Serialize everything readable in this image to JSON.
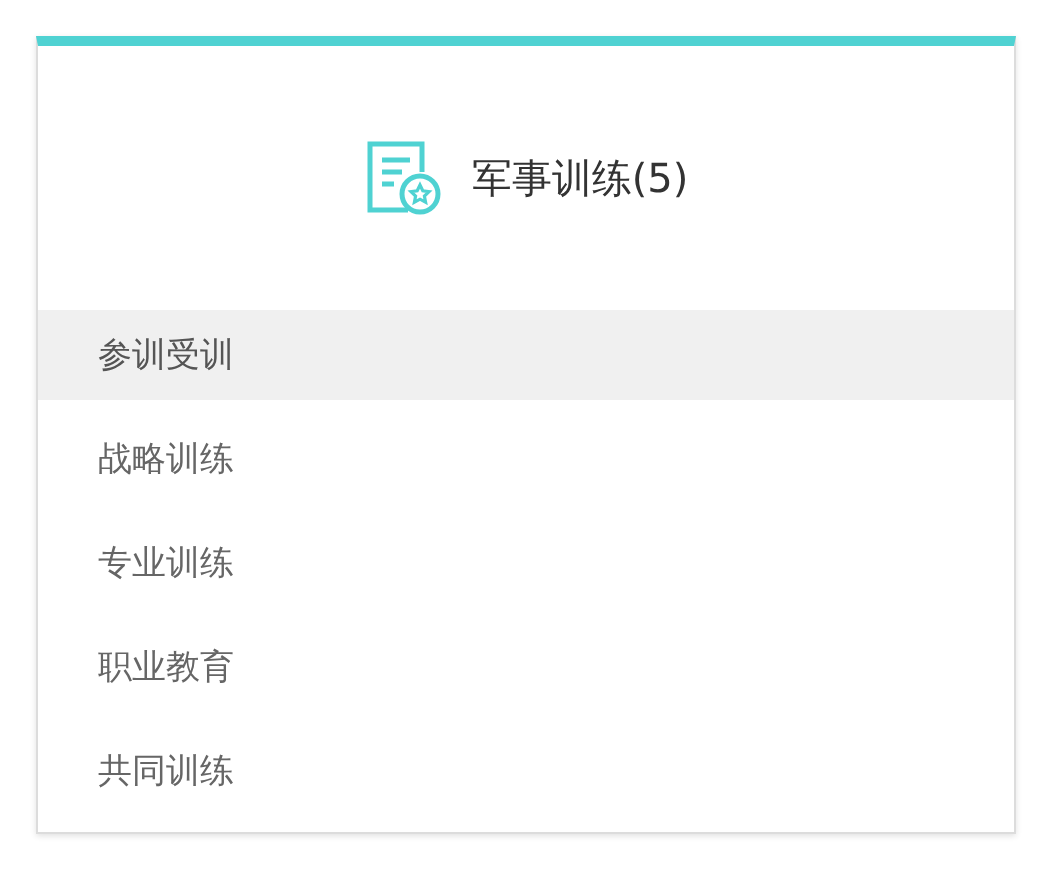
{
  "card": {
    "title": "军事训练(5)"
  },
  "items": [
    {
      "label": "参训受训",
      "selected": true
    },
    {
      "label": "战略训练",
      "selected": false
    },
    {
      "label": "专业训练",
      "selected": false
    },
    {
      "label": "职业教育",
      "selected": false
    },
    {
      "label": "共同训练",
      "selected": false
    }
  ]
}
